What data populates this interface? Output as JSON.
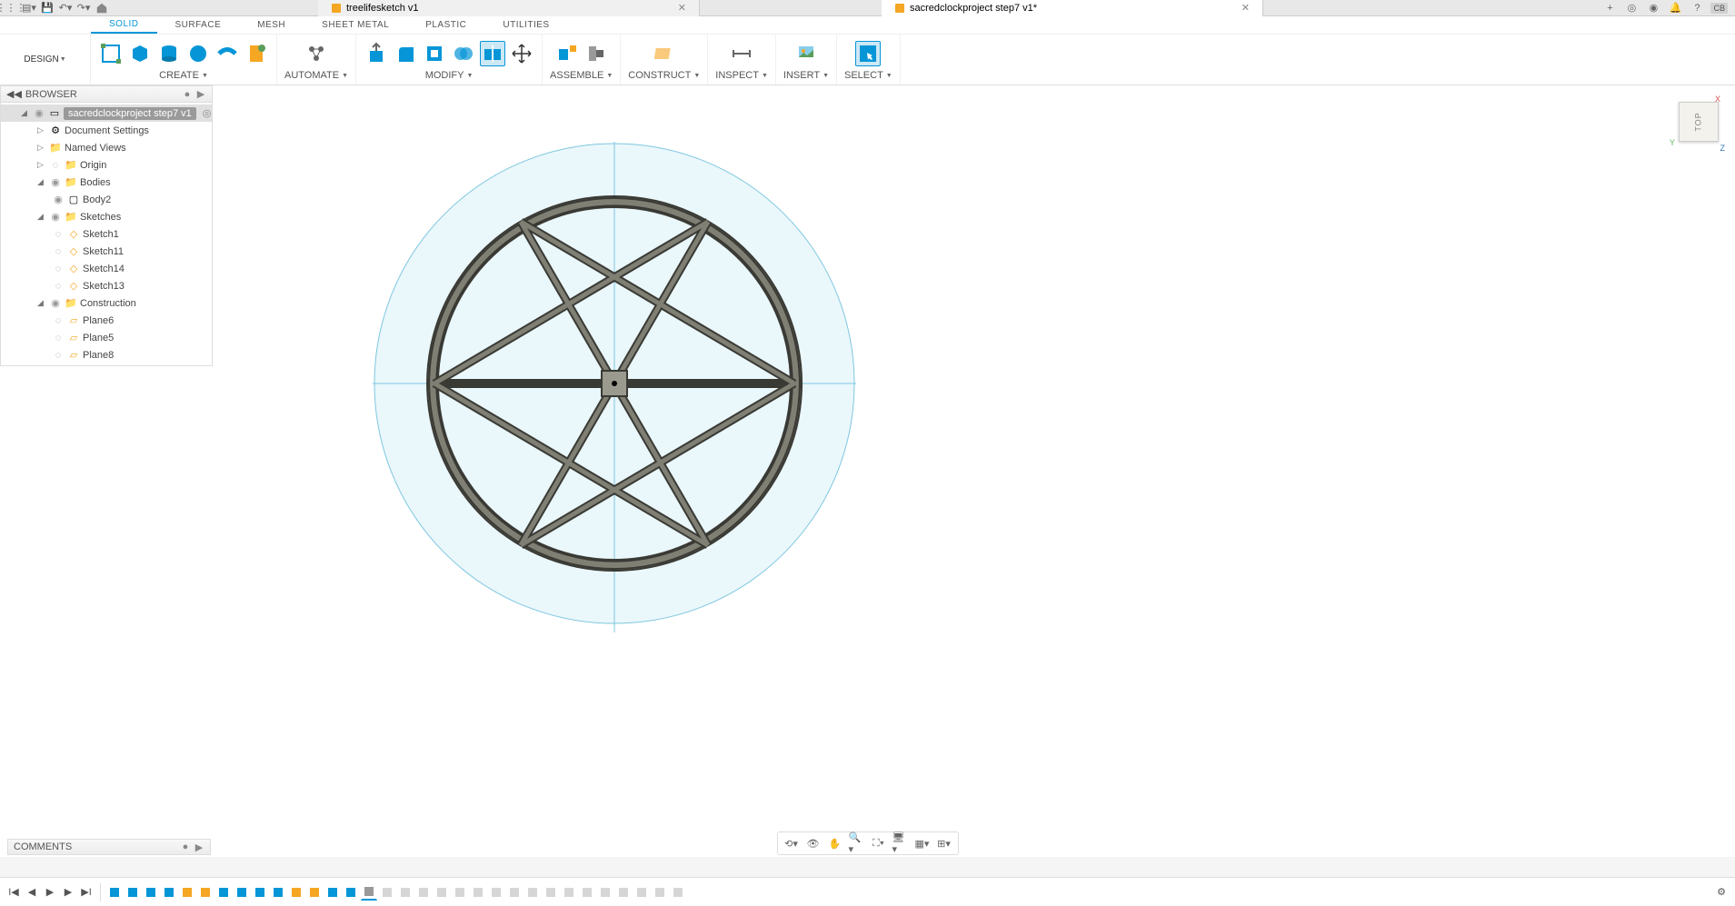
{
  "titlebar": {
    "tabs": [
      {
        "name": "treelifesketch v1",
        "active": false
      },
      {
        "name": "sacredclockproject step7 v1*",
        "active": true
      }
    ],
    "user_initials": "CB"
  },
  "ribbon": {
    "design_label": "DESIGN",
    "tabs": [
      "SOLID",
      "SURFACE",
      "MESH",
      "SHEET METAL",
      "PLASTIC",
      "UTILITIES"
    ],
    "active_tab": "SOLID",
    "groups": {
      "create": "CREATE",
      "automate": "AUTOMATE",
      "modify": "MODIFY",
      "assemble": "ASSEMBLE",
      "construct": "CONSTRUCT",
      "inspect": "INSPECT",
      "insert": "INSERT",
      "select": "SELECT"
    }
  },
  "browser": {
    "title": "BROWSER",
    "root": "sacredclockproject step7 v1",
    "items": {
      "document_settings": "Document Settings",
      "named_views": "Named Views",
      "origin": "Origin",
      "bodies": "Bodies",
      "body2": "Body2",
      "sketches": "Sketches",
      "sketch1": "Sketch1",
      "sketch11": "Sketch11",
      "sketch14": "Sketch14",
      "sketch13": "Sketch13",
      "construction": "Construction",
      "plane6": "Plane6",
      "plane5": "Plane5",
      "plane8": "Plane8"
    }
  },
  "viewcube": {
    "face": "TOP",
    "axes": {
      "x": "X",
      "y": "Y",
      "z": "Z"
    }
  },
  "comments": {
    "title": "COMMENTS"
  },
  "timeline": {
    "item_count": 32
  }
}
